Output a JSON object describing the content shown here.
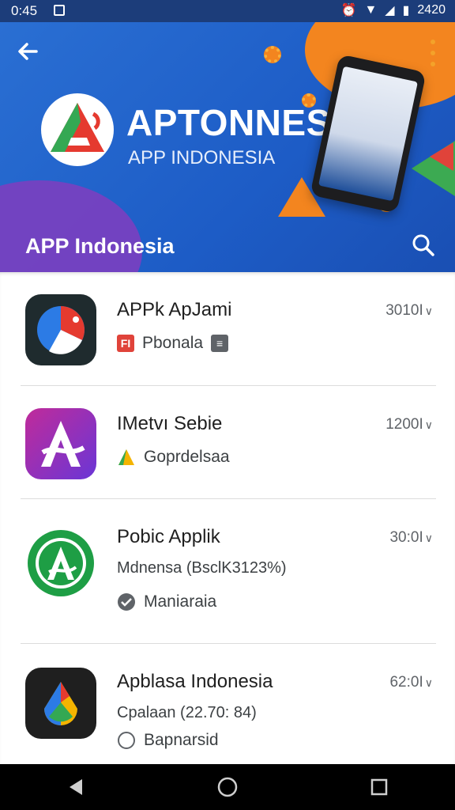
{
  "status_bar": {
    "time": "0:45",
    "clock_right": "2420"
  },
  "header": {
    "brand_title": "APTONNESIA",
    "brand_subtitle": "APP INDONESIA",
    "page_title": "APP Indonesia",
    "colors": {
      "primary": "#1d5cc6",
      "accent": "#f3851f",
      "purple": "#7b3fc0"
    }
  },
  "apps": [
    {
      "title": "APPk ApJami",
      "size": "3010I",
      "meta_label": "Pbonala",
      "badge_text": "FI",
      "icon": "compass-app-icon"
    },
    {
      "title": "IMetvı Sebie",
      "size": "1200I",
      "meta_label": "Goprdelsaa",
      "icon": "letter-a-app-icon"
    },
    {
      "title": "Pobic Applik",
      "size": "30:0I",
      "meta_label": "Mdnensa (BsclK3123%)",
      "meta2": "Maniaraia",
      "icon": "green-a-app-icon"
    },
    {
      "title": "Apblasa Indonesia",
      "size": "62:0I",
      "meta_label": "Cpalaan (22.70: 84)",
      "meta2": "Bapnarsid",
      "icon": "drop-app-icon"
    }
  ],
  "nav": {
    "back": "back-triangle-icon",
    "home": "home-circle-icon",
    "recents": "recents-square-icon"
  }
}
